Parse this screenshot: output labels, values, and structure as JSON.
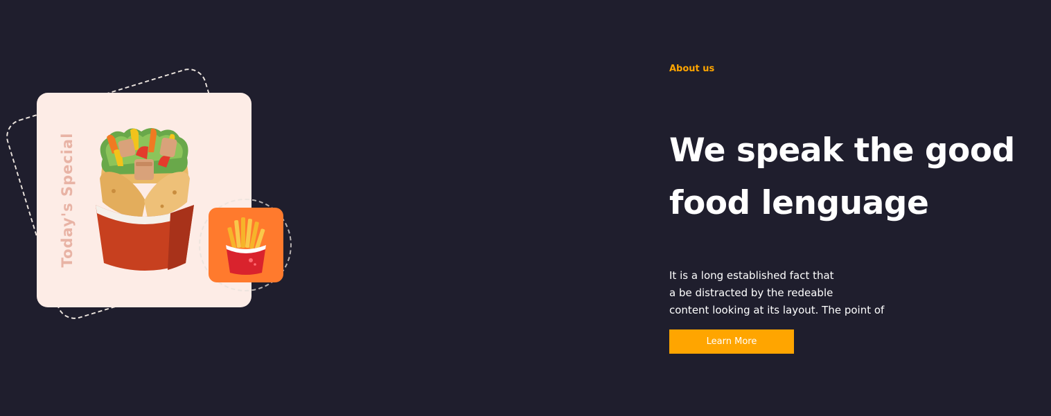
{
  "colors": {
    "background": "#1f1e2d",
    "accent": "#ffa500",
    "card": "#fdece6",
    "fries_card": "#ff7a2d",
    "special_text": "#e8b3a5"
  },
  "illustration": {
    "card_text": "Today's Special",
    "main_icon": "wrap-icon",
    "side_icon": "fries-icon"
  },
  "about": {
    "label": "About us",
    "headline": [
      "We speak the good",
      "food lenguage"
    ],
    "body": [
      "It is a long established fact that",
      "a be distracted by the redeable",
      "content looking at its layout. The point of"
    ],
    "button_label": "Learn More"
  }
}
